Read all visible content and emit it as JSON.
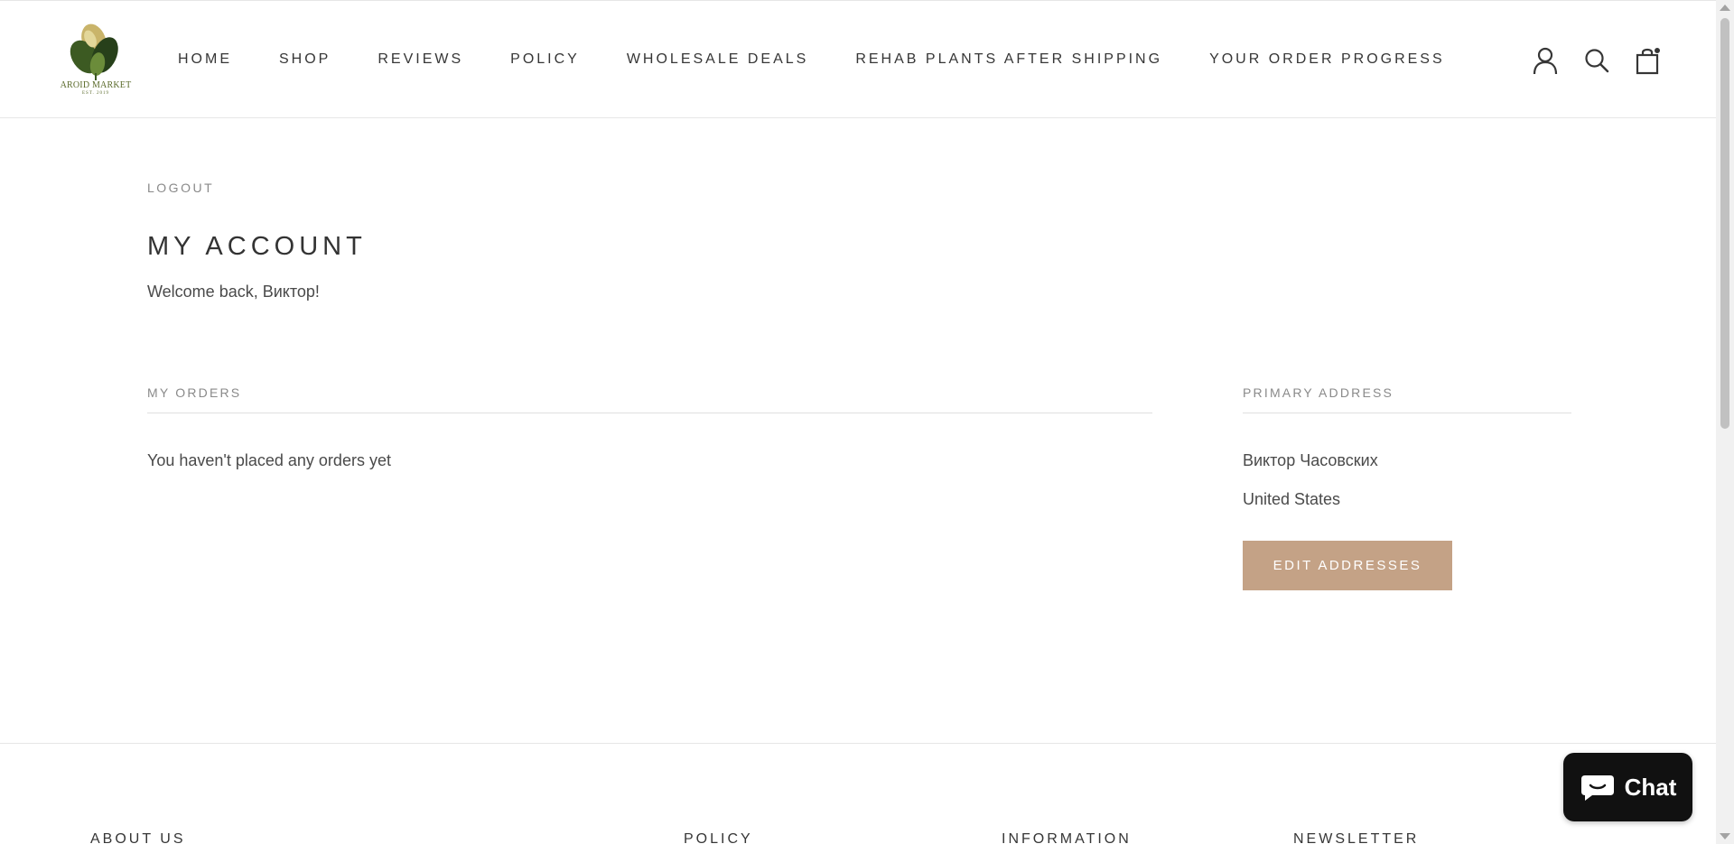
{
  "header": {
    "logo_text": "AROID MARKET",
    "logo_sub": "EST. 2019",
    "nav": [
      {
        "label": "HOME"
      },
      {
        "label": "SHOP"
      },
      {
        "label": "REVIEWS"
      },
      {
        "label": "POLICY"
      },
      {
        "label": "WHOLESALE DEALS"
      },
      {
        "label": "REHAB PLANTS AFTER SHIPPING"
      },
      {
        "label": "YOUR ORDER PROGRESS"
      }
    ],
    "icons": [
      "account-icon",
      "search-icon",
      "cart-icon"
    ]
  },
  "account": {
    "logout": "LOGOUT",
    "title": "MY ACCOUNT",
    "welcome": "Welcome back, Виктор!"
  },
  "orders": {
    "heading": "MY ORDERS",
    "empty_message": "You haven't placed any orders yet"
  },
  "address": {
    "heading": "PRIMARY ADDRESS",
    "name": "Виктор Часовских",
    "country": "United States",
    "edit_button": "EDIT ADDRESSES"
  },
  "footer": {
    "columns": [
      "ABOUT US",
      "POLICY",
      "INFORMATION",
      "NEWSLETTER"
    ]
  },
  "chat": {
    "label": "Chat"
  },
  "colors": {
    "accent_button": "#c4a286",
    "text": "#333333",
    "muted": "#8a8a8a"
  }
}
